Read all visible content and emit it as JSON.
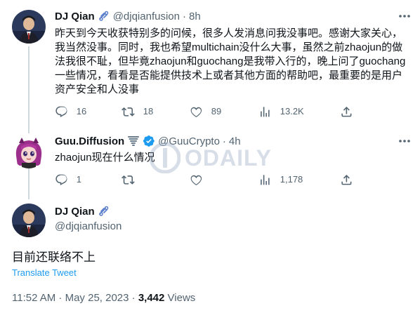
{
  "tweets": [
    {
      "name": "DJ Qian",
      "handle": "@djqianfusion",
      "dot": "·",
      "time": "8h",
      "text": "昨天到今天收获特别多的问候，很多人发消息问我没事吧。感谢大家关心，我当然没事。同时，我也希望multichain没什么大事，虽然之前zhaojun的做法我很不耻，但毕竟zhaojun和guochang是我带入行的，晚上问了guochang一些情况，看看是否能提供技术上或者其他方面的帮助吧，最重要的是用户资产安全和人没事",
      "replies": "16",
      "retweets": "18",
      "likes": "89",
      "views": "13.2K"
    },
    {
      "name": "Guu.Diffusion",
      "handle": "@GuuCrypto",
      "dot": "·",
      "time": "4h",
      "text": "zhaojun现在什么情况",
      "replies": "1",
      "retweets": "",
      "likes": "",
      "views": "1,178"
    }
  ],
  "main": {
    "name": "DJ Qian",
    "handle": "@djqianfusion",
    "text": "目前还联络不上",
    "translate": "Translate Tweet",
    "timestamp": "11:52 AM · May 25, 2023 · ",
    "views_count": "3,442",
    "views_label": " Views"
  },
  "watermark": "ODAILY",
  "colors": {
    "accent": "#1d9bf0",
    "muted": "#536471",
    "text": "#0f1419",
    "verified": "#1d9bf0"
  }
}
